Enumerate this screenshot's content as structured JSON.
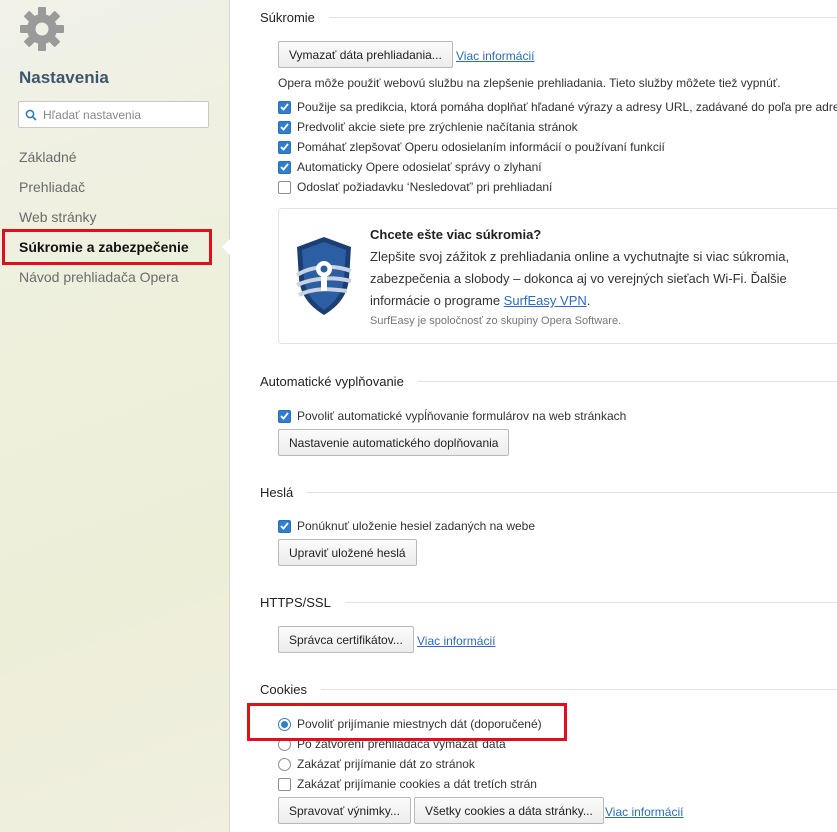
{
  "sidebar": {
    "title": "Nastavenia",
    "search_placeholder": "Hľadať nastavenia",
    "items": [
      {
        "label": "Základné"
      },
      {
        "label": "Prehliadač"
      },
      {
        "label": "Web stránky"
      },
      {
        "label": "Súkromie a zabezpečenie"
      },
      {
        "label": "Návod prehliadača Opera"
      }
    ]
  },
  "privacy": {
    "heading": "Súkromie",
    "clear_button": "Vymazať dáta prehliadania...",
    "more_info": "Viac informácií",
    "description": "Opera môže použiť webovú službu na zlepšenie prehliadania. Tieto služby môžete tiež vypnúť.",
    "options": [
      {
        "label": "Použije sa predikcia, ktorá pomáha doplňať hľadané výrazy a adresy URL, zadávané do poľa pre adresu",
        "checked": true
      },
      {
        "label": "Predvoliť akcie siete pre zrýchlenie načítania stránok",
        "checked": true
      },
      {
        "label": "Pomáhať zlepšovať Operu odosielaním informácií o používaní funkcií",
        "checked": true
      },
      {
        "label": "Automaticky Opere odosielať správy o zlyhaní",
        "checked": true
      },
      {
        "label": "Odoslať požiadavku ‘Nesledovať’ pri prehliadaní",
        "checked": false
      }
    ]
  },
  "vpn": {
    "title": "Chcete ešte viac súkromia?",
    "body_line1": "Zlepšite svoj zážitok z prehliadania online a vychutnajte si viac súkromia,",
    "body_line2": "zabezpečenia a slobody – dokonca aj vo verejných sieťach Wi-Fi. Ďalšie",
    "body_line3_prefix": "informácie o programe ",
    "link": "SurfEasy VPN",
    "body_line3_suffix": ".",
    "note": "SurfEasy je spoločnosť zo skupiny Opera Software."
  },
  "autofill": {
    "heading": "Automatické vyplňovanie",
    "option": "Povoliť automatické vypĺňovanie formulárov na web stránkach",
    "option_checked": true,
    "button": "Nastavenie automatického doplňovania"
  },
  "passwords": {
    "heading": "Heslá",
    "option": "Ponúknuť uloženie hesiel zadaných na webe",
    "option_checked": true,
    "button": "Upraviť uložené heslá"
  },
  "https": {
    "heading": "HTTPS/SSL",
    "button": "Správca certifikátov...",
    "more_info": "Viac informácií"
  },
  "cookies": {
    "heading": "Cookies",
    "options": [
      {
        "label": "Povoliť prijímanie miestnych dát (doporučené)",
        "type": "radio",
        "checked": true
      },
      {
        "label": "Po zatvorení prehliadača vymazať dáta",
        "type": "radio",
        "checked": false
      },
      {
        "label": "Zakázať prijímanie dát zo stránok",
        "type": "radio",
        "checked": false
      },
      {
        "label": "Zakázať prijímanie cookies a dát tretích strán",
        "type": "checkbox",
        "checked": false
      }
    ],
    "exceptions_button": "Spravovať výnimky...",
    "all_cookies_button": "Všetky cookies a dáta stránky...",
    "more_info": "Viac informácií"
  },
  "colors": {
    "accent": "#2f7fd0",
    "highlight": "#e0101a",
    "link": "#2a6ac8"
  }
}
